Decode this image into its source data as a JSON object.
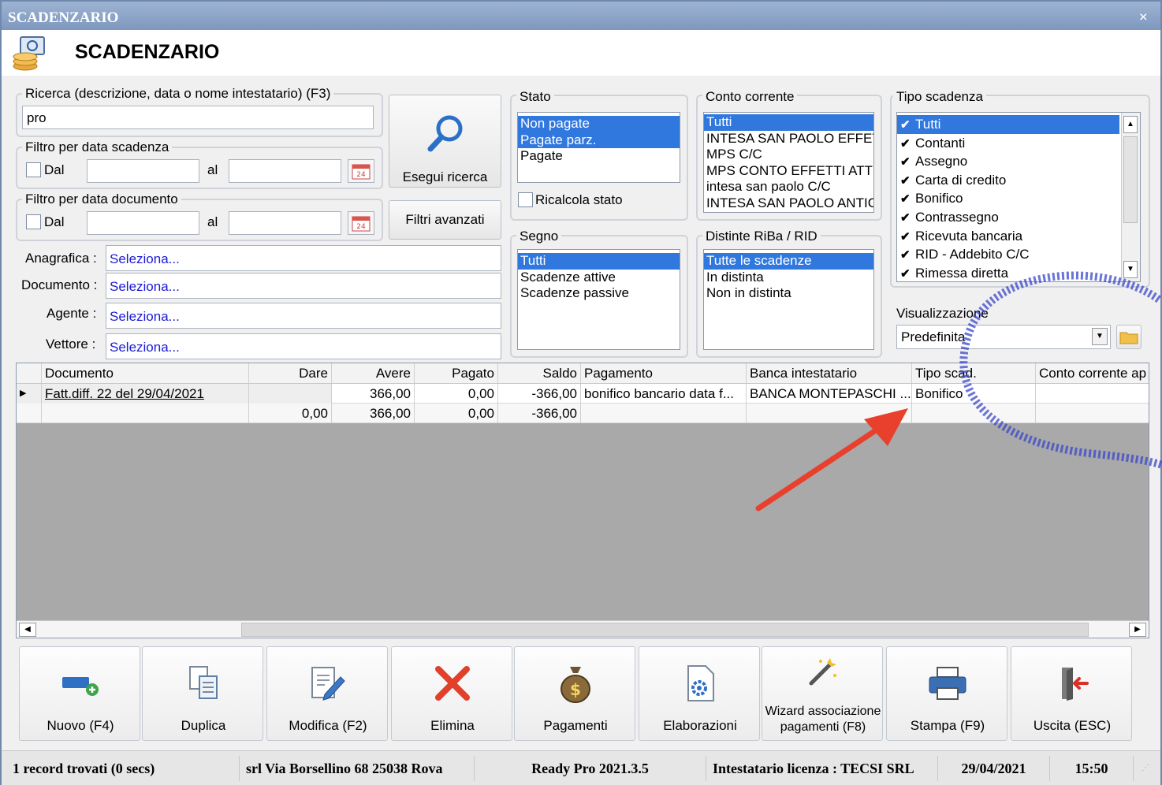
{
  "window": {
    "title": "SCADENZARIO",
    "close": "×"
  },
  "header": {
    "title": "SCADENZARIO"
  },
  "search": {
    "label": "Ricerca (descrizione, data o nome intestatario) (F3)",
    "value": "pro",
    "due_filter_label": "Filtro per data scadenza",
    "doc_filter_label": "Filtro per data documento",
    "from": "Dal",
    "to": "al",
    "calendar_day": "24",
    "run_button": "Esegui ricerca",
    "advanced_button": "Filtri avanzati"
  },
  "selectors": [
    {
      "label": "Anagrafica :",
      "value": "Seleziona..."
    },
    {
      "label": "Documento :",
      "value": "Seleziona..."
    },
    {
      "label": "Agente :",
      "value": "Seleziona..."
    },
    {
      "label": "Vettore :",
      "value": "Seleziona..."
    }
  ],
  "stato": {
    "label": "Stato",
    "items": [
      "Non pagate",
      "Pagate parz.",
      "Pagate"
    ],
    "recalc": "Ricalcola stato"
  },
  "conto": {
    "label": "Conto corrente",
    "items": [
      "Tutti",
      "INTESA SAN PAOLO EFFETTI",
      "MPS C/C",
      "MPS CONTO EFFETTI ATTIV",
      "intesa san paolo C/C",
      "INTESA SAN PAOLO ANTICI"
    ]
  },
  "tipo": {
    "label": "Tipo scadenza",
    "items": [
      "Tutti",
      "Contanti",
      "Assegno",
      "Carta di credito",
      "Bonifico",
      "Contrassegno",
      "Ricevuta bancaria",
      "RID - Addebito C/C",
      "Rimessa diretta"
    ]
  },
  "segno": {
    "label": "Segno",
    "items": [
      "Tutti",
      "Scadenze attive",
      "Scadenze passive"
    ]
  },
  "distinte": {
    "label": "Distinte RiBa / RID",
    "items": [
      "Tutte le scadenze",
      "In distinta",
      "Non in distinta"
    ]
  },
  "view": {
    "label": "Visualizzazione",
    "value": "Predefinita"
  },
  "grid": {
    "columns": [
      "Documento",
      "Dare",
      "Avere",
      "Pagato",
      "Saldo",
      "Pagamento",
      "Banca intestatario",
      "Tipo scad.",
      "Conto corrente ap"
    ],
    "rows": [
      [
        "Fatt.diff. 22 del 29/04/2021",
        "",
        "366,00",
        "0,00",
        "-366,00",
        "bonifico bancario data f...",
        "BANCA MONTEPASCHI ...",
        "Bonifico",
        ""
      ]
    ],
    "totals": [
      "",
      "0,00",
      "366,00",
      "0,00",
      "-366,00",
      "",
      "",
      "",
      ""
    ]
  },
  "toolbar": [
    {
      "label": "Nuovo (F4)",
      "icon": "new-record-icon"
    },
    {
      "label": "Duplica",
      "icon": "duplicate-icon"
    },
    {
      "label": "Modifica (F2)",
      "icon": "edit-icon"
    },
    {
      "label": "Elimina",
      "icon": "delete-icon"
    },
    {
      "label": "Pagamenti",
      "icon": "money-bag-icon"
    },
    {
      "label": "Elaborazioni",
      "icon": "processing-icon"
    },
    {
      "label": "Wizard associazione pagamenti (F8)",
      "icon": "wizard-icon"
    },
    {
      "label": "Stampa (F9)",
      "icon": "printer-icon"
    },
    {
      "label": "Uscita (ESC)",
      "icon": "exit-icon"
    }
  ],
  "status": {
    "records": "1 record trovati (0 secs)",
    "company": "srl Via Borsellino 68  25038 Rova",
    "version": "Ready Pro 2021.3.5",
    "license": "Intestatario licenza : TECSI SRL",
    "date": "29/04/2021",
    "time": "15:50"
  },
  "colors": {
    "selection": "#3077de",
    "title_bar": "#7e98bd",
    "grid_empty": "#a9a9a9",
    "link": "#1a1ad4",
    "delete": "#e2402b",
    "annotation_arrow": "#e8402c",
    "annotation_circle": "#3a47c9"
  }
}
